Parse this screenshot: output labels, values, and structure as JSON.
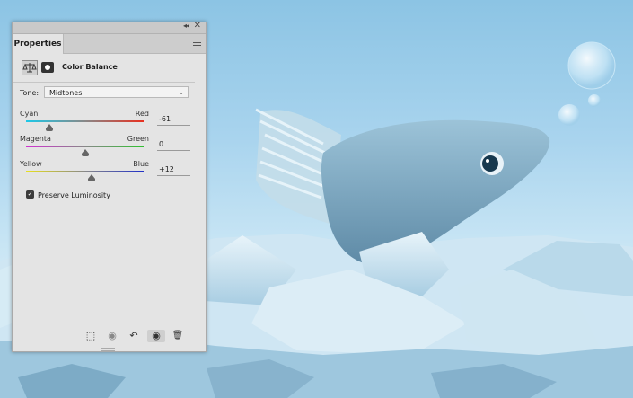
{
  "panel": {
    "tab_label": "Properties",
    "header_title": "Color Balance",
    "tone_label": "Tone:",
    "tone_value": "Midtones",
    "sliders": [
      {
        "left": "Cyan",
        "right": "Red",
        "value": "-61",
        "level": -61,
        "colors": [
          "#1ec8e8",
          "#e83020"
        ]
      },
      {
        "left": "Magenta",
        "right": "Green",
        "value": "0",
        "level": 0,
        "colors": [
          "#d030d0",
          "#30c030"
        ]
      },
      {
        "left": "Yellow",
        "right": "Blue",
        "value": "+12",
        "level": 12,
        "colors": [
          "#e8e020",
          "#2030c8"
        ]
      }
    ],
    "preserve_luminosity_label": "Preserve Luminosity",
    "preserve_luminosity_checked": true,
    "check_glyph": "✓",
    "collapse_glyph": "◂◂",
    "close_glyph": "✕",
    "chevron_glyph": "⌄",
    "footer_icons": [
      {
        "name": "clip-to-layer-icon",
        "glyph": "⬚"
      },
      {
        "name": "view-previous-icon",
        "glyph": "◉"
      },
      {
        "name": "reset-icon",
        "glyph": "↶"
      },
      {
        "name": "visibility-eye-icon",
        "glyph": "◉"
      },
      {
        "name": "trash-icon",
        "glyph": "🗑"
      }
    ]
  }
}
